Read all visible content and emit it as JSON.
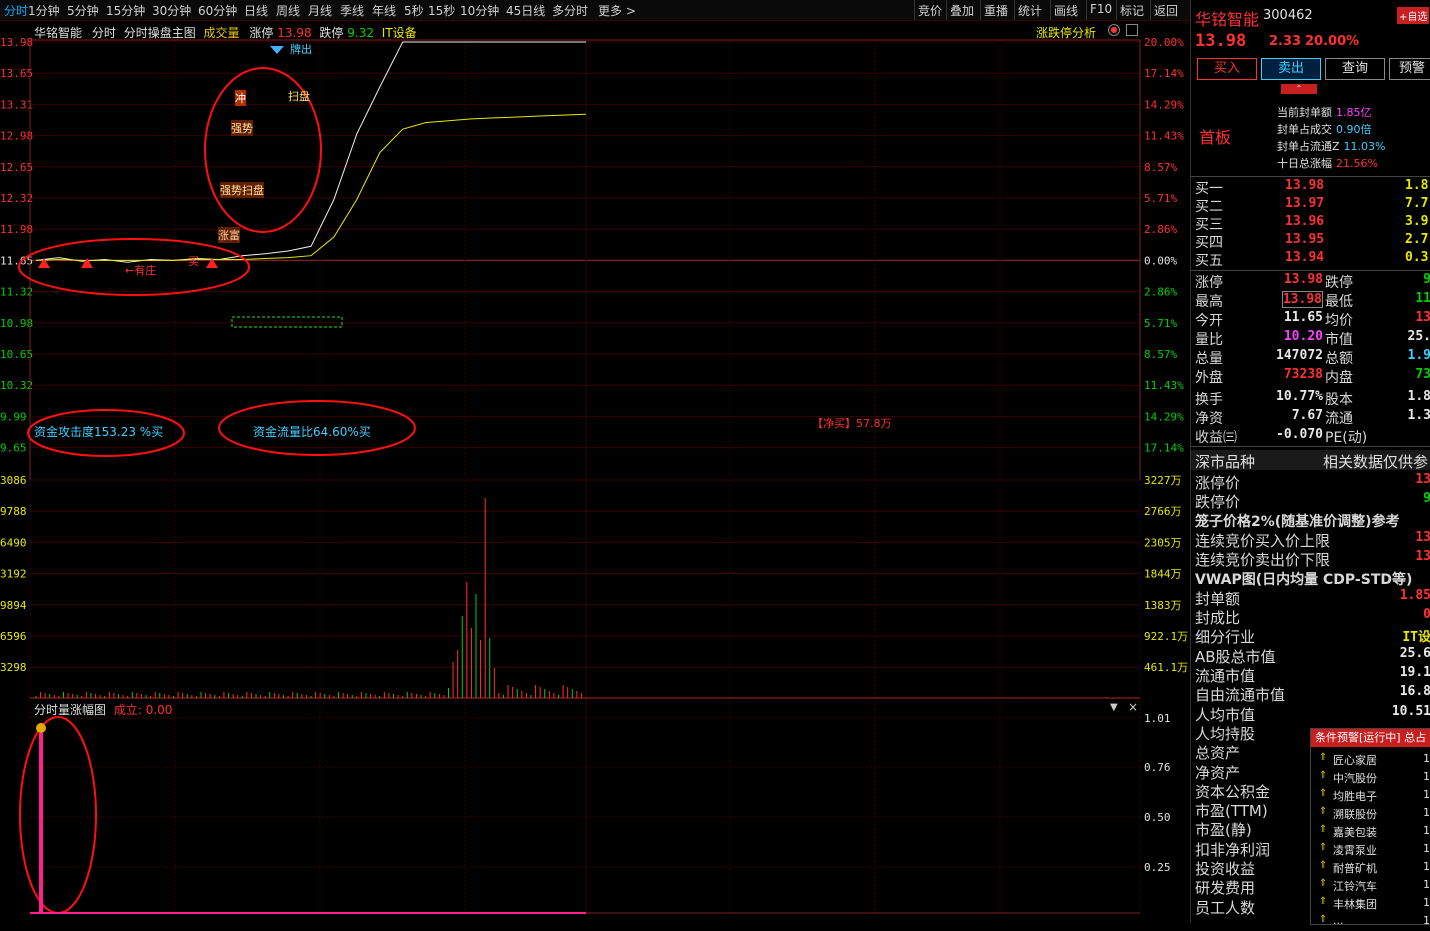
{
  "toolbar": {
    "left_items": [
      "分时",
      "1分钟",
      "5分钟",
      "15分钟",
      "30分钟",
      "60分钟",
      "日线",
      "周线",
      "月线",
      "季线",
      "年线",
      "5秒",
      "15秒",
      "10分钟",
      "45日线",
      "多分时",
      "更多 >"
    ],
    "right_items": [
      "竞价",
      "叠加",
      "重播",
      "统计",
      "画线",
      "F10",
      "标记",
      "返回"
    ]
  },
  "chart_header": {
    "stock": "华铭智能",
    "period": "分时",
    "indicator": "分时操盘主图",
    "volume_label": "成交量",
    "limit_up_label": "涨停",
    "limit_up_value": "13.98",
    "limit_down_label": "跌停",
    "limit_down_value": "9.32",
    "sector": "IT设备",
    "analysis": "涨跌停分析"
  },
  "price_axis": {
    "left": [
      "13.98",
      "13.65",
      "13.31",
      "12.98",
      "12.65",
      "12.32",
      "11.98",
      "11.65",
      "11.32",
      "10.98",
      "10.65",
      "10.32",
      "9.99",
      "9.65"
    ],
    "right": [
      "20.00%",
      "17.14%",
      "14.29%",
      "11.43%",
      "8.57%",
      "5.71%",
      "2.86%",
      "0.00%",
      "2.86%",
      "5.71%",
      "8.57%",
      "11.43%",
      "14.29%",
      "17.14%"
    ]
  },
  "volume_axis": {
    "left": [
      "3086",
      "9788",
      "6490",
      "3192",
      "9894",
      "6596",
      "3298"
    ],
    "right": [
      "3227万",
      "2766万",
      "2305万",
      "1844万",
      "1383万",
      "922.1万",
      "461.1万"
    ]
  },
  "sub_axis": [
    "1.01",
    "0.76",
    "0.50",
    "0.25"
  ],
  "annotations": {
    "attack": "资金攻击度153.23 %买",
    "flow": "资金流量比64.60%买",
    "net_buy": "【净买】57.8万",
    "youzhuang": "←有庄",
    "buy": "买",
    "zhangtu": "涨富",
    "qiangshi_saopan": "强势扫盘",
    "qiangshi": "强势",
    "chong": "冲",
    "sao_pan": "扫盘",
    "pai_chu": "牌出",
    "pi": "买"
  },
  "sub_chart": {
    "title": "分时量涨幅图",
    "deal_label": "成立:",
    "deal_value": "0.00"
  },
  "right_panel": {
    "name": "华铭智能",
    "code": "300462",
    "add_fav": "+自选",
    "price": "13.98",
    "change": "2.33",
    "change_pct": "20.00%",
    "buttons": [
      "买入",
      "卖出",
      "查询",
      "预警"
    ],
    "first_board": "首板",
    "seal_info": [
      {
        "label": "当前封单额",
        "value": "1.85亿"
      },
      {
        "label": "封单占成交",
        "value": "0.90倍"
      },
      {
        "label": "封单占流通Z",
        "value": "11.03%"
      },
      {
        "label": "十日总涨幅",
        "value": "21.56%"
      }
    ],
    "bids": [
      {
        "label": "买一",
        "price": "13.98",
        "vol": "1.8"
      },
      {
        "label": "买二",
        "price": "13.97",
        "vol": "7.7"
      },
      {
        "label": "买三",
        "price": "13.96",
        "vol": "3.9"
      },
      {
        "label": "买四",
        "price": "13.95",
        "vol": "2.7"
      },
      {
        "label": "买五",
        "price": "13.94",
        "vol": "0.3"
      }
    ],
    "stats": [
      {
        "l1": "涨停",
        "v1": "13.98",
        "l2": "跌停",
        "v2": "9"
      },
      {
        "l1": "最高",
        "v1": "13.98",
        "l2": "最低",
        "v2": "11"
      },
      {
        "l1": "今开",
        "v1": "11.65",
        "l2": "均价",
        "v2": "13"
      },
      {
        "l1": "量比",
        "v1": "10.20",
        "l2": "市值",
        "v2": "25."
      },
      {
        "l1": "总量",
        "v1": "147072",
        "l2": "总额",
        "v2": "1.9"
      },
      {
        "l1": "外盘",
        "v1": "73238",
        "l2": "内盘",
        "v2": "73"
      },
      {
        "l1": "换手",
        "v1": "10.77%",
        "l2": "股本",
        "v2": "1.8"
      },
      {
        "l1": "净资",
        "v1": "7.67",
        "l2": "流通",
        "v2": "1.3"
      },
      {
        "l1": "收益㈢",
        "v1": "-0.070",
        "l2": "PE(动)",
        "v2": ""
      }
    ],
    "info_header": "深市品种",
    "info_header_right": "相关数据仅供参",
    "info_rows": [
      {
        "label": "涨停价",
        "value": "13"
      },
      {
        "label": "跌停价",
        "value": "9"
      },
      {
        "label": "笼子价格2%(随基准价调整)参考",
        "value": ""
      },
      {
        "label": "连续竞价买入价上限",
        "value": "13"
      },
      {
        "label": "连续竞价卖出价下限",
        "value": "13"
      },
      {
        "label": "VWAP图(日内均量 CDP-STD等)",
        "value": ""
      },
      {
        "label": "封单额",
        "value": "1.85"
      },
      {
        "label": "封成比",
        "value": "0"
      },
      {
        "label": "细分行业",
        "value": "IT设"
      },
      {
        "label": "AB股总市值",
        "value": "25.6"
      },
      {
        "label": "流通市值",
        "value": "19.1"
      },
      {
        "label": "自由流通市值",
        "value": "16.8"
      },
      {
        "label": "人均市值",
        "value": "10.51"
      },
      {
        "label": "人均持股",
        "value": ""
      },
      {
        "label": "总资产",
        "value": ""
      },
      {
        "label": "净资产",
        "value": ""
      },
      {
        "label": "资本公积金",
        "value": ""
      },
      {
        "label": "市盈(TTM)",
        "value": ""
      },
      {
        "label": "市盈(静)",
        "value": ""
      },
      {
        "label": "扣非净利润",
        "value": ""
      },
      {
        "label": "投资收益",
        "value": ""
      },
      {
        "label": "研发费用",
        "value": ""
      },
      {
        "label": "员工人数",
        "value": ""
      }
    ],
    "alert_title": "条件预警[运行中] 总占",
    "alerts": [
      "匠心家居",
      "中汽股份",
      "均胜电子",
      "溯联股份",
      "嘉美包装",
      "凌霄泵业",
      "耐普矿机",
      "江铃汽车",
      "丰林集团",
      "..."
    ]
  },
  "chart_data": {
    "type": "line",
    "title": "华铭智能 分时",
    "price_ylim": [
      9.32,
      13.98
    ],
    "prev_close": 11.65,
    "x": [
      0,
      10,
      20,
      30,
      40,
      50,
      60,
      70,
      80,
      90,
      100,
      110,
      120,
      130,
      140,
      150,
      160,
      170,
      180,
      190,
      200,
      210,
      220,
      230,
      240
    ],
    "series": [
      {
        "name": "price",
        "values": [
          11.65,
          11.68,
          11.64,
          11.66,
          11.63,
          11.66,
          11.65,
          11.67,
          11.66,
          11.7,
          11.72,
          11.75,
          11.8,
          12.3,
          13.0,
          13.5,
          13.98,
          13.98,
          13.98,
          13.98,
          13.98,
          13.98,
          13.98,
          13.98,
          13.98
        ]
      },
      {
        "name": "avg",
        "values": [
          11.65,
          11.66,
          11.65,
          11.65,
          11.65,
          11.65,
          11.65,
          11.66,
          11.66,
          11.66,
          11.67,
          11.68,
          11.7,
          11.9,
          12.3,
          12.8,
          13.05,
          13.12,
          13.14,
          13.16,
          13.17,
          13.18,
          13.19,
          13.2,
          13.21
        ]
      }
    ]
  }
}
